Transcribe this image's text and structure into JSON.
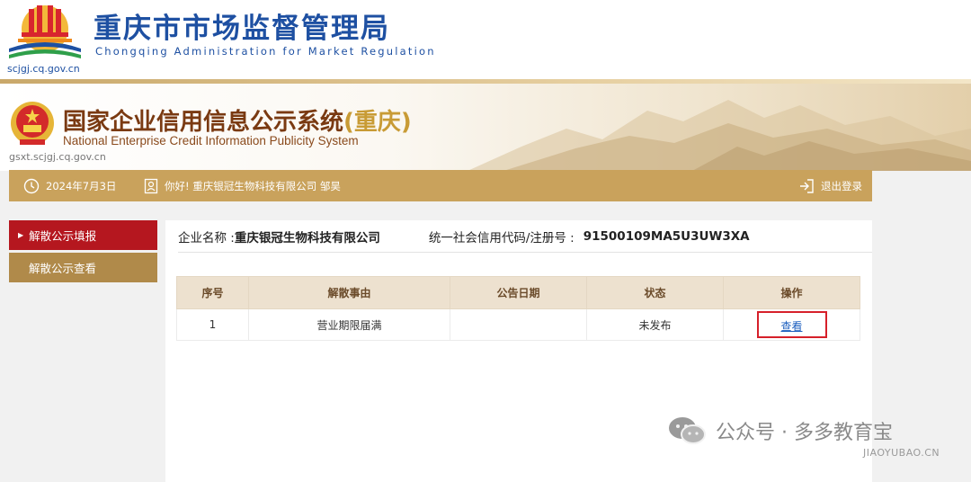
{
  "market": {
    "title": "重庆市市场监督管理局",
    "subtitle": "Chongqing Administration for Market Regulation",
    "domain": "scjgj.cq.gov.cn"
  },
  "system": {
    "title": "国家企业信用信息公示系统",
    "title_region": "(重庆)",
    "subtitle": "National Enterprise Credit Information Publicity System",
    "domain": "gsxt.scjgj.cq.gov.cn"
  },
  "info_bar": {
    "date": "2024年7月3日",
    "greeting": "你好! 重庆银冠生物科技有限公司  邹昊",
    "logout": "退出登录"
  },
  "side_nav": [
    {
      "label": "解散公示填报",
      "active": true
    },
    {
      "label": "解散公示查看",
      "active": false
    }
  ],
  "company": {
    "name_label": "企业名称 : ",
    "name_value": "重庆银冠生物科技有限公司",
    "code_label": "统一社会信用代码/注册号 :",
    "code_value": "91500109MA5U3UW3XA"
  },
  "table": {
    "headers": [
      "序号",
      "解散事由",
      "公告日期",
      "状态",
      "操作"
    ],
    "rows": [
      {
        "index": "1",
        "reason": "营业期限届满",
        "date": "",
        "status": "未发布",
        "action": "查看"
      }
    ]
  },
  "watermark": {
    "text": "公众号 · 多多教育宝",
    "sub": "JIAOYUBAO.CN"
  },
  "colors": {
    "brand_blue": "#1e50a2",
    "gold_bar": "#c9a25c",
    "active_red": "#b5171f",
    "highlight_red": "#d6202a",
    "link_blue": "#1c5fbf"
  }
}
